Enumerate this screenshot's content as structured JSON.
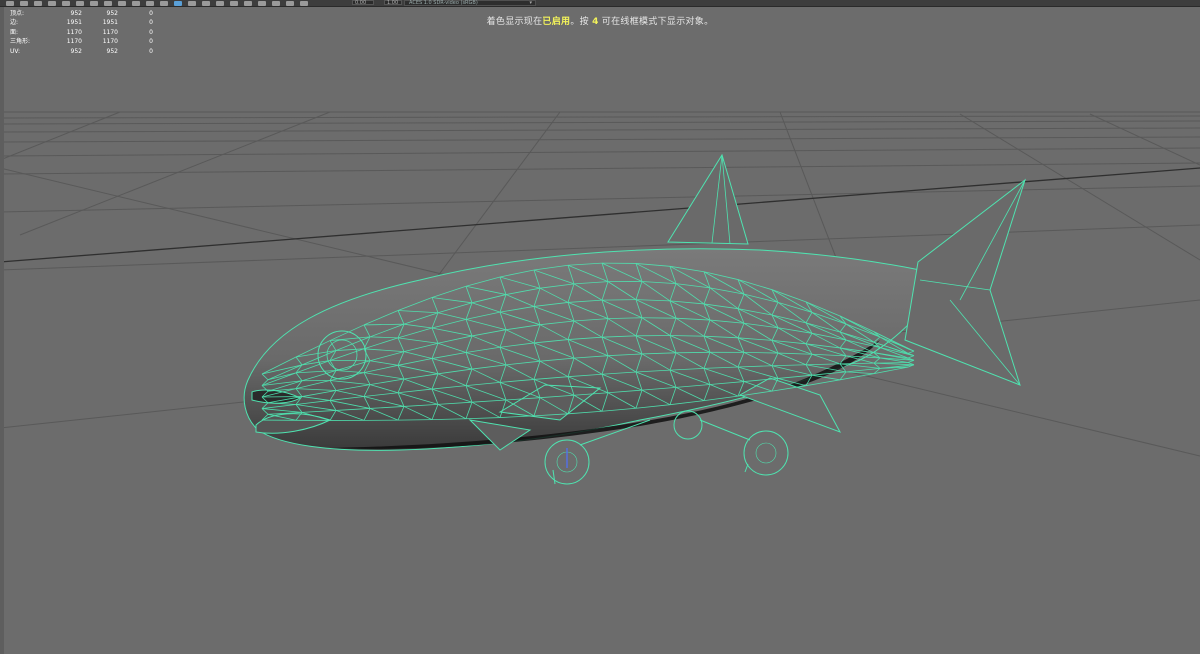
{
  "toolbar": {
    "field_a": "0.00",
    "field_b": "1.00",
    "colorspace": "ACES 1.0 SDR-video (sRGB)"
  },
  "hud": {
    "rows": [
      {
        "label": "顶点:",
        "v1": "952",
        "v2": "952",
        "v3": "0"
      },
      {
        "label": "边:",
        "v1": "1951",
        "v2": "1951",
        "v3": "0"
      },
      {
        "label": "面:",
        "v1": "1170",
        "v2": "1170",
        "v3": "0"
      },
      {
        "label": "三角形:",
        "v1": "1170",
        "v2": "1170",
        "v3": "0"
      },
      {
        "label": "UV:",
        "v1": "952",
        "v2": "952",
        "v3": "0"
      }
    ]
  },
  "message": {
    "part1": "着色显示现在",
    "highlight1": "已启用",
    "part2": "。按 ",
    "highlight2": "4",
    "part3": " 可在线框模式下显示对象。"
  },
  "colors": {
    "background": "#6c6c6c",
    "grid": "#5a5a5a",
    "wire": "#4fe3b0",
    "message_highlight": "#f2f25a"
  },
  "icons": [
    "toolbar-tool-icon",
    "colorspace-dropdown-icon"
  ]
}
